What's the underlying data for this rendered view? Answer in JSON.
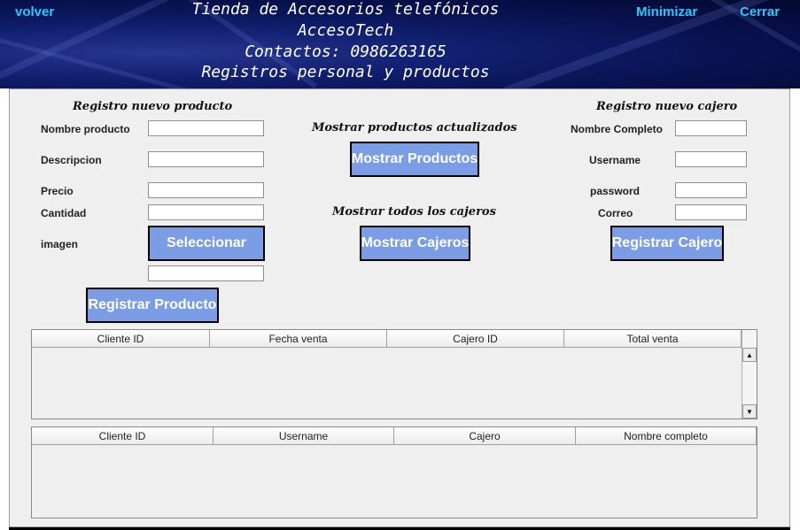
{
  "header": {
    "back_label": "volver",
    "minimize_label": "Minimizar",
    "close_label": "Cerrar",
    "title_lines": [
      "Tienda de Accesorios telefónicos",
      "AccesoTech",
      "Contactos: 0986263165",
      "Registros personal y productos"
    ]
  },
  "producto": {
    "title": "Registro nuevo producto",
    "nombre_label": "Nombre producto",
    "descripcion_label": "Descripcion",
    "precio_label": "Precio",
    "cantidad_label": "Cantidad",
    "imagen_label": "imagen",
    "seleccionar_label": "Seleccionar",
    "registrar_label": "Registrar Producto"
  },
  "centro": {
    "productos_title": "Mostrar productos actualizados",
    "mostrar_productos_label": "Mostrar Productos",
    "cajeros_title": "Mostrar todos los cajeros",
    "mostrar_cajeros_label": "Mostrar Cajeros"
  },
  "cajero": {
    "title": "Registro nuevo cajero",
    "nombre_label": "Nombre Completo",
    "username_label": "Username",
    "password_label": "password",
    "correo_label": "Correo",
    "registrar_label": "Registrar Cajero"
  },
  "tabla_ventas": {
    "columns": [
      "Cliente ID",
      "Fecha venta",
      "Cajero ID",
      "Total venta"
    ]
  },
  "tabla_cajeros": {
    "columns": [
      "Cliente ID",
      "Username",
      "Cajero",
      "Nombre completo"
    ]
  },
  "colors": {
    "button_bg": "#7b9de6",
    "nav_text": "#29c8ff",
    "header_bg": "#101f6e"
  }
}
